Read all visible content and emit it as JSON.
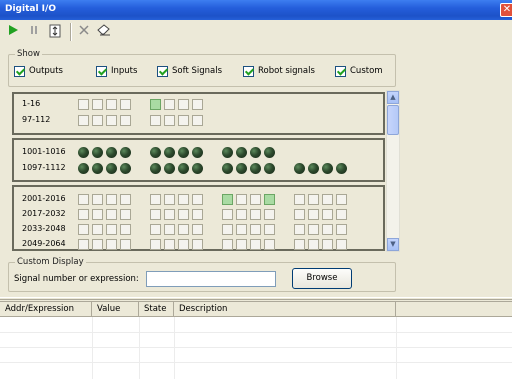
{
  "window": {
    "title": "Digital I/O",
    "close_glyph": "✕"
  },
  "toolbar": {
    "buttons": [
      {
        "name": "play-icon",
        "glyph": "▶",
        "color": "#21a121"
      },
      {
        "name": "pause-icon",
        "glyph": "❙❙",
        "color": "#9a9a9a"
      },
      {
        "name": "step-icon",
        "glyph": "⇕",
        "color": "#555555"
      },
      {
        "name": "delete-icon",
        "glyph": "✕",
        "color": "#8a8a8a"
      },
      {
        "name": "eraser-icon",
        "glyph": "⌫",
        "color": "#555555"
      }
    ]
  },
  "show": {
    "legend": "Show",
    "options": [
      {
        "label": "Outputs",
        "checked": true
      },
      {
        "label": "Inputs",
        "checked": true
      },
      {
        "label": "Soft Signals",
        "checked": true
      },
      {
        "label": "Robot signals",
        "checked": true
      },
      {
        "label": "Custom",
        "checked": true
      }
    ]
  },
  "panels": {
    "outputs": {
      "rows": [
        {
          "label": "1-16",
          "on": [
            4
          ]
        },
        {
          "label": "97-112",
          "on": []
        }
      ]
    },
    "robot": {
      "rows": [
        {
          "label": "1001-1016",
          "groups": 3
        },
        {
          "label": "1097-1112",
          "groups": 4
        }
      ]
    },
    "soft": {
      "rows": [
        {
          "label": "2001-2016",
          "on": [
            8,
            11
          ]
        },
        {
          "label": "2017-2032",
          "on": []
        },
        {
          "label": "2033-2048",
          "on": []
        },
        {
          "label": "2049-2064",
          "on": []
        }
      ]
    }
  },
  "custom": {
    "legend": "Custom Display",
    "signal_label": "Signal number or expression:",
    "signal_value": "",
    "browse_label": "Browse"
  },
  "table": {
    "columns": [
      "Addr/Expression",
      "Value",
      "State",
      "Description"
    ],
    "rows": []
  },
  "colors": {
    "signal_on": "#a9dba3",
    "signal_off": "#f4f3ee",
    "titlebar": "#245edb"
  }
}
